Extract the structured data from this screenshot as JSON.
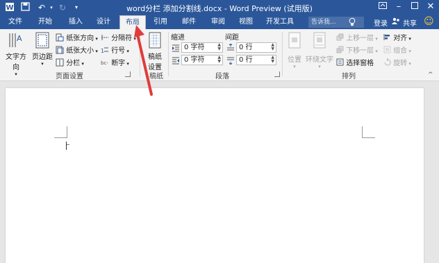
{
  "window": {
    "title": "word分栏 添加分割线.docx - Word Preview (试用版)",
    "login": "登录",
    "share": "共享",
    "smiley": "☺"
  },
  "tabs": [
    {
      "label": "文件"
    },
    {
      "label": "开始"
    },
    {
      "label": "插入"
    },
    {
      "label": "设计"
    },
    {
      "label": "布局"
    },
    {
      "label": "引用"
    },
    {
      "label": "邮件"
    },
    {
      "label": "审阅"
    },
    {
      "label": "视图"
    },
    {
      "label": "开发工具"
    }
  ],
  "search_placeholder": "告诉我...",
  "ribbon": {
    "page_setup": {
      "text_direction": "文字方向",
      "margins": "页边距",
      "orientation": "纸张方向",
      "size": "纸张大小",
      "columns": "分栏",
      "breaks": "分隔符",
      "line_numbers": "行号",
      "hyphenation": "断字",
      "group_label": "页面设置"
    },
    "manuscript": {
      "button": "稿纸设置",
      "button_line1": "稿纸",
      "button_line2": "设置",
      "group_label": "稿纸"
    },
    "paragraph": {
      "indent_header": "缩进",
      "spacing_header": "间距",
      "indent_left": "0 字符",
      "indent_right": "0 字符",
      "spacing_before": "0 行",
      "spacing_after": "0 行",
      "group_label": "段落"
    },
    "arrange": {
      "position": "位置",
      "wrap_text": "环绕文字",
      "bring_forward": "上移一层",
      "send_backward": "下移一层",
      "selection_pane": "选择窗格",
      "align": "对齐",
      "group": "组合",
      "rotate": "旋转",
      "group_label": "排列"
    }
  },
  "colors": {
    "accent": "#2b579a",
    "arrow": "#e03c3c"
  }
}
